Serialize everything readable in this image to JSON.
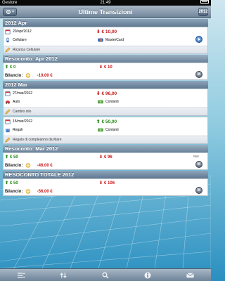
{
  "status": {
    "carrier": "Gestore",
    "time": "21:49"
  },
  "nav": {
    "title": "Ultime Transizioni",
    "year_button": "2012"
  },
  "sections": {
    "apr_header": "2012 Apr",
    "apr_tx": {
      "date": "20/apr/2012",
      "category": "Cellulare",
      "amount": "€ 10,00",
      "method": "MasterCard",
      "note": "Ricarica Cellulare"
    },
    "apr_summary_header": "Resoconto: Apr 2012",
    "apr_summary": {
      "in": "€ 0",
      "out": "€ 10",
      "balance_label": "Bilancio:",
      "balance": "-10,00 €",
      "badge": "M"
    },
    "mar_header": "2012 Mar",
    "mar_tx1": {
      "date": "27/mar/2012",
      "category": "Auto",
      "amount": "€ 96,00",
      "method": "Contanti",
      "note": "Cambio olio"
    },
    "mar_tx2": {
      "date": "15/mar/2012",
      "category": "Regali",
      "amount": "€ 50,00",
      "method": "Contanti",
      "note": "Regalo di compleanno da Mare"
    },
    "mar_summary_header": "Resoconto: Mar 2012",
    "mar_summary": {
      "in": "€ 50",
      "out": "€ 96",
      "balance_label": "Bilancio:",
      "balance": "-46,00 €",
      "side_label": "Mar",
      "badge": "M"
    },
    "total_header": "RESOCONTO TOTALE 2012",
    "total_summary": {
      "in": "€ 50",
      "out": "€ 106",
      "balance_label": "Bilancio:",
      "balance": "-56,00 €",
      "badge": "M"
    }
  },
  "colors": {
    "income": "#2a8a1a",
    "expense": "#c81818",
    "navbar": "#6f8499"
  }
}
